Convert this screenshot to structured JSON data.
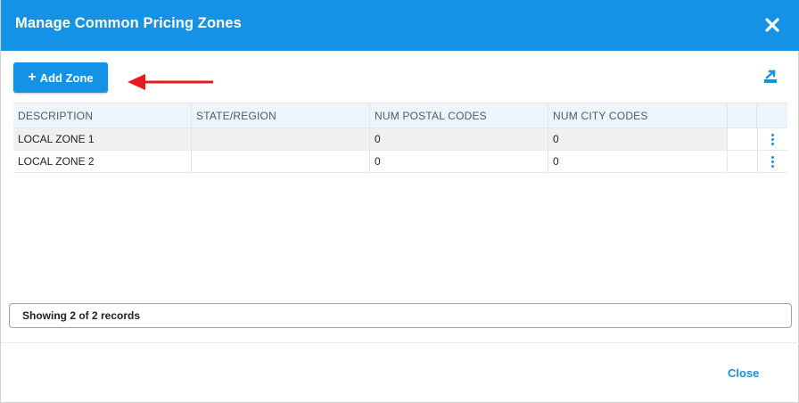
{
  "dialog": {
    "title": "Manage Common Pricing Zones",
    "close_icon": "close-icon",
    "accent_color": "#1492e6"
  },
  "toolbar": {
    "add_zone_label": "Add Zone",
    "add_icon": "plus-icon",
    "export_icon": "export-icon"
  },
  "grid": {
    "columns": [
      "DESCRIPTION",
      "STATE/REGION",
      "NUM POSTAL CODES",
      "NUM CITY CODES"
    ],
    "rows": [
      {
        "description": "LOCAL ZONE 1",
        "state_region": "",
        "num_postal_codes": "0",
        "num_city_codes": "0",
        "menu_icon": "kebab-menu-icon"
      },
      {
        "description": "LOCAL ZONE 2",
        "state_region": "",
        "num_postal_codes": "0",
        "num_city_codes": "0",
        "menu_icon": "kebab-menu-icon"
      }
    ]
  },
  "status": {
    "records_text": "Showing 2 of 2 records"
  },
  "footer": {
    "close_label": "Close"
  },
  "annotation": {
    "arrow_color": "#e8191a"
  }
}
